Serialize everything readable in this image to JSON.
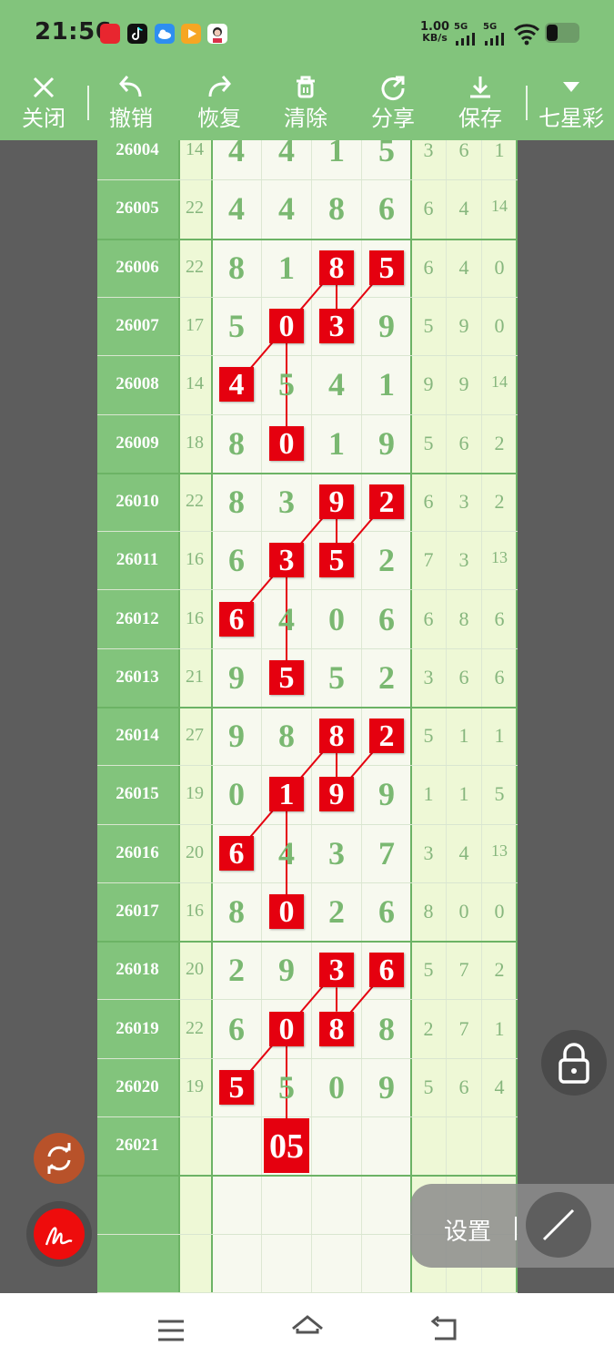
{
  "status_bar": {
    "time": "21:56",
    "net_speed_value": "1.00",
    "net_speed_unit": "KB/s",
    "signal1_label": "5G",
    "signal2_label": "5G",
    "icons": [
      "app-red-icon",
      "tiktok-icon",
      "cloud-icon",
      "video-icon",
      "avatar-icon",
      "wifi-icon",
      "battery-icon"
    ]
  },
  "toolbar": {
    "close": "关闭",
    "undo": "撤销",
    "redo": "恢复",
    "clear": "清除",
    "share": "分享",
    "save": "保存",
    "game": "七星彩"
  },
  "colors": {
    "bar_green": "#82c47c",
    "issue_green": "#82c47c",
    "hit_red": "#e5000f",
    "digit_green": "#7ab871",
    "background": "#5d5d5d"
  },
  "rows": [
    {
      "issue": "26004",
      "sum": "14",
      "digits": [
        "4",
        "4",
        "1",
        "5"
      ],
      "stats": [
        "3",
        "6",
        "1"
      ],
      "hits": []
    },
    {
      "issue": "26005",
      "sum": "22",
      "digits": [
        "4",
        "4",
        "8",
        "6"
      ],
      "stats": [
        "6",
        "4",
        "14"
      ],
      "hits": []
    },
    {
      "issue": "26006",
      "sum": "22",
      "digits": [
        "8",
        "1",
        "8",
        "5"
      ],
      "stats": [
        "6",
        "4",
        "0"
      ],
      "hits": [
        2,
        3
      ]
    },
    {
      "issue": "26007",
      "sum": "17",
      "digits": [
        "5",
        "0",
        "3",
        "9"
      ],
      "stats": [
        "5",
        "9",
        "0"
      ],
      "hits": [
        1,
        2
      ]
    },
    {
      "issue": "26008",
      "sum": "14",
      "digits": [
        "4",
        "5",
        "4",
        "1"
      ],
      "stats": [
        "9",
        "9",
        "14"
      ],
      "hits": [
        0
      ]
    },
    {
      "issue": "26009",
      "sum": "18",
      "digits": [
        "8",
        "0",
        "1",
        "9"
      ],
      "stats": [
        "5",
        "6",
        "2"
      ],
      "hits": [
        1
      ]
    },
    {
      "issue": "26010",
      "sum": "22",
      "digits": [
        "8",
        "3",
        "9",
        "2"
      ],
      "stats": [
        "6",
        "3",
        "2"
      ],
      "hits": [
        2,
        3
      ]
    },
    {
      "issue": "26011",
      "sum": "16",
      "digits": [
        "6",
        "3",
        "5",
        "2"
      ],
      "stats": [
        "7",
        "3",
        "13"
      ],
      "hits": [
        1,
        2
      ]
    },
    {
      "issue": "26012",
      "sum": "16",
      "digits": [
        "6",
        "4",
        "0",
        "6"
      ],
      "stats": [
        "6",
        "8",
        "6"
      ],
      "hits": [
        0
      ]
    },
    {
      "issue": "26013",
      "sum": "21",
      "digits": [
        "9",
        "5",
        "5",
        "2"
      ],
      "stats": [
        "3",
        "6",
        "6"
      ],
      "hits": [
        1
      ]
    },
    {
      "issue": "26014",
      "sum": "27",
      "digits": [
        "9",
        "8",
        "8",
        "2"
      ],
      "stats": [
        "5",
        "1",
        "1"
      ],
      "hits": [
        2,
        3
      ]
    },
    {
      "issue": "26015",
      "sum": "19",
      "digits": [
        "0",
        "1",
        "9",
        "9"
      ],
      "stats": [
        "1",
        "1",
        "5"
      ],
      "hits": [
        1,
        2
      ]
    },
    {
      "issue": "26016",
      "sum": "20",
      "digits": [
        "6",
        "4",
        "3",
        "7"
      ],
      "stats": [
        "3",
        "4",
        "13"
      ],
      "hits": [
        0
      ]
    },
    {
      "issue": "26017",
      "sum": "16",
      "digits": [
        "8",
        "0",
        "2",
        "6"
      ],
      "stats": [
        "8",
        "0",
        "0"
      ],
      "hits": [
        1
      ]
    },
    {
      "issue": "26018",
      "sum": "20",
      "digits": [
        "2",
        "9",
        "3",
        "6"
      ],
      "stats": [
        "5",
        "7",
        "2"
      ],
      "hits": [
        2,
        3
      ]
    },
    {
      "issue": "26019",
      "sum": "22",
      "digits": [
        "6",
        "0",
        "8",
        "8"
      ],
      "stats": [
        "2",
        "7",
        "1"
      ],
      "hits": [
        1,
        2
      ]
    },
    {
      "issue": "26020",
      "sum": "19",
      "digits": [
        "5",
        "5",
        "0",
        "9"
      ],
      "stats": [
        "5",
        "6",
        "4"
      ],
      "hits": [
        0
      ]
    },
    {
      "issue": "26021",
      "sum": "",
      "digits": [
        "",
        "",
        "",
        ""
      ],
      "stats": [
        "",
        "",
        ""
      ],
      "hits": []
    }
  ],
  "prediction": {
    "issue": "26021",
    "value": "05"
  },
  "floating": {
    "settings_label": "设置",
    "lock_icon": "lock-icon",
    "sync_icon": "sync-icon",
    "draw_icon": "signature-icon",
    "line_tool_icon": "line-tool-icon"
  },
  "nav_bar": {
    "icons": [
      "menu-icon",
      "home-icon",
      "back-icon"
    ]
  }
}
